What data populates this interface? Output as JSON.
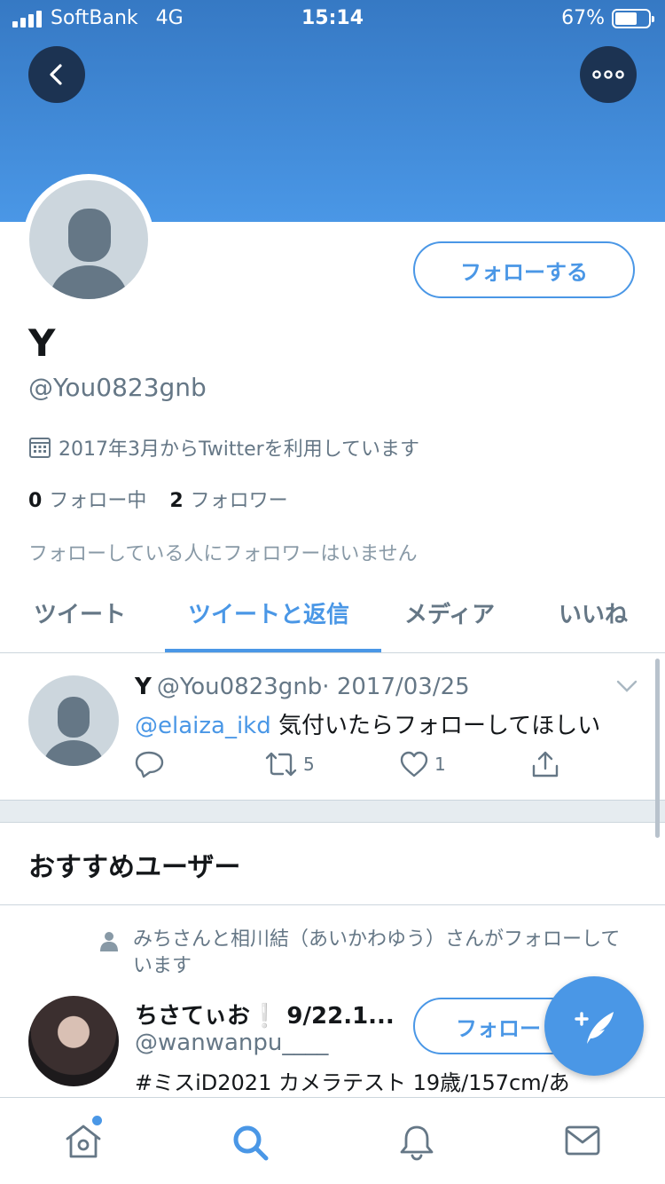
{
  "status_bar": {
    "carrier": "SoftBank",
    "network": "4G",
    "time": "15:14",
    "battery": "67%",
    "battery_level": 0.67
  },
  "profile": {
    "name": "Y",
    "handle": "@You0823gnb",
    "joined": "2017年3月からTwitterを利用しています",
    "following_count": "0",
    "following_label": "フォロー中",
    "followers_count": "2",
    "followers_label": "フォロワー",
    "no_followers_note": "フォローしている人にフォロワーはいません",
    "follow_button": "フォローする"
  },
  "tabs": [
    {
      "label": "ツイート",
      "active": false
    },
    {
      "label": "ツイートと返信",
      "active": true
    },
    {
      "label": "メディア",
      "active": false
    },
    {
      "label": "いいね",
      "active": false
    }
  ],
  "tweet": {
    "name": "Y",
    "handle": "@You0823gnb",
    "date": "· 2017/03/25",
    "mention": "@elaiza_ikd",
    "text": " 気付いたらフォローしてほしい",
    "retweets": "5",
    "likes": "1"
  },
  "recommended": {
    "title": "おすすめユーザー",
    "context": "みちさんと相川結（あいかわゆう）さんがフォローしています",
    "name": "ちさてぃお❕ 9/22.1...",
    "handle": "@wanwanpu____",
    "bio": "#ミスiD2021 カメラテスト 19歳/157cm/あ",
    "follow_button": "フォロー"
  },
  "colors": {
    "accent": "#4a97e6",
    "banner_top": "#3679c4",
    "banner_bottom": "#4a97e6",
    "text_secondary": "#657786"
  },
  "icons": [
    "back-icon",
    "more-icon",
    "calendar-icon",
    "reply-icon",
    "retweet-icon",
    "like-icon",
    "share-icon",
    "person-icon",
    "compose-icon",
    "home-icon",
    "search-icon",
    "bell-icon",
    "mail-icon",
    "chevron-down-icon"
  ]
}
